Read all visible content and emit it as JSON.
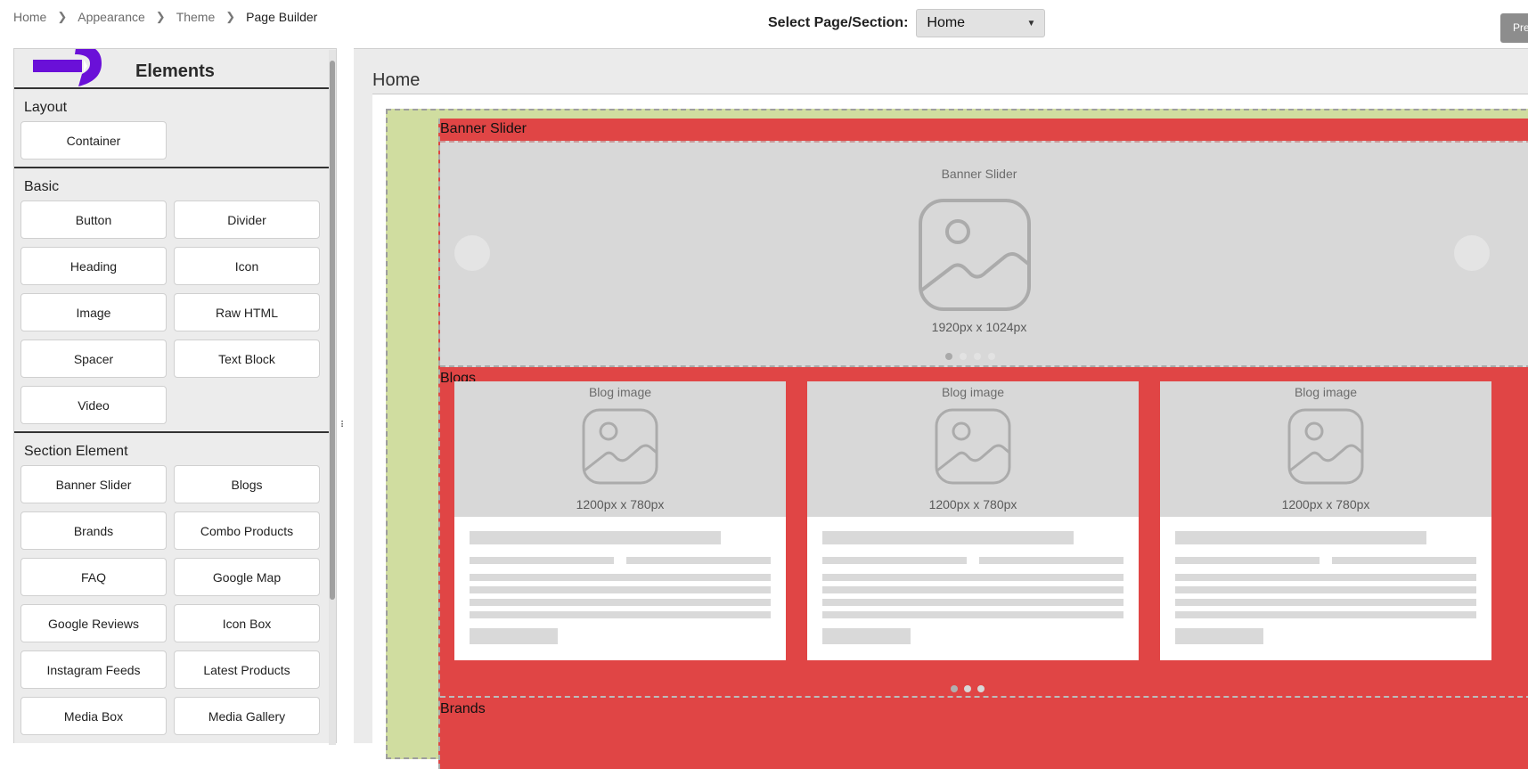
{
  "breadcrumb": [
    "Home",
    "Appearance",
    "Theme",
    "Page Builder"
  ],
  "page_select": {
    "label": "Select Page/Section:",
    "value": "Home"
  },
  "preview_button": "Pre",
  "panel": {
    "title": "Elements",
    "groups": [
      {
        "title": "Layout",
        "items": [
          "Container"
        ]
      },
      {
        "title": "Basic",
        "items": [
          "Button",
          "Divider",
          "Heading",
          "Icon",
          "Image",
          "Raw HTML",
          "Spacer",
          "Text Block",
          "Video"
        ]
      },
      {
        "title": "Section Element",
        "items": [
          "Banner Slider",
          "Blogs",
          "Brands",
          "Combo Products",
          "FAQ",
          "Google Map",
          "Google Reviews",
          "Icon Box",
          "Instagram Feeds",
          "Latest Products",
          "Media Box",
          "Media Gallery"
        ]
      }
    ]
  },
  "canvas": {
    "title": "Home",
    "banner": {
      "section_label": "Banner Slider",
      "caption": "Banner Slider",
      "size": "1920px x 1024px",
      "dot_count": 4,
      "active_dot": 0
    },
    "blogs": {
      "section_label": "Blogs",
      "cards": [
        {
          "caption": "Blog image",
          "size": "1200px x 780px"
        },
        {
          "caption": "Blog image",
          "size": "1200px x 780px"
        },
        {
          "caption": "Blog image",
          "size": "1200px x 780px"
        }
      ],
      "dot_count": 3,
      "active_dot": 0
    },
    "brands": {
      "section_label": "Brands"
    }
  },
  "colors": {
    "section_bg": "#e04545",
    "container_bg": "#d0dda0",
    "placeholder_bg": "#d8d8d8",
    "arrow": "#6a10d8"
  }
}
